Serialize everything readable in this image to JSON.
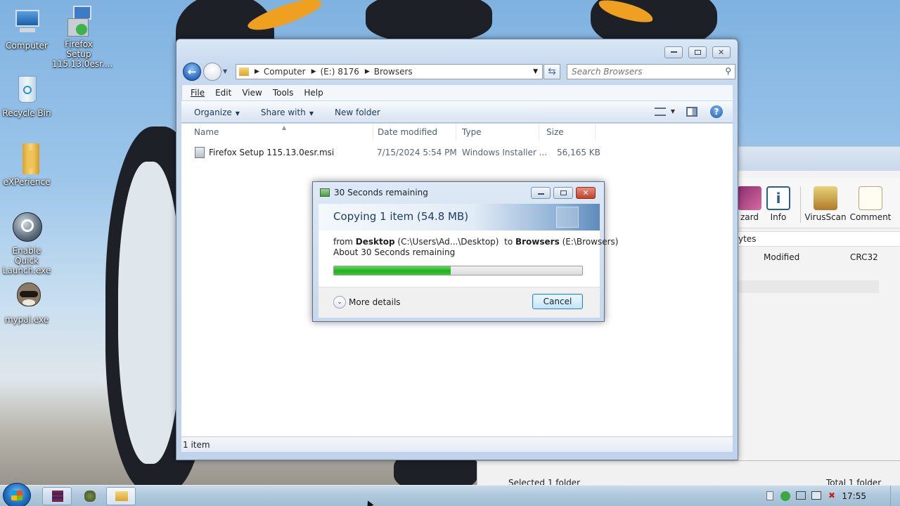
{
  "desktop": {
    "icons": [
      {
        "label": "Computer",
        "icon": "computer-icon"
      },
      {
        "label": "Firefox Setup 115.13.0esr....",
        "icon": "installer-icon"
      },
      {
        "label": "Recycle Bin",
        "icon": "recycle-bin-icon"
      },
      {
        "label": "eXPerience",
        "icon": "folder-icon"
      },
      {
        "label": "Enable Quick Launch.exe",
        "icon": "quick-launch-icon"
      },
      {
        "label": "mypal.exe",
        "icon": "raccoon-icon"
      }
    ]
  },
  "explorer": {
    "breadcrumb": [
      "Computer",
      "(E:) 8176",
      "Browsers"
    ],
    "search_placeholder": "Search Browsers",
    "menu": [
      "File",
      "Edit",
      "View",
      "Tools",
      "Help"
    ],
    "toolbar": {
      "organize": "Organize",
      "share_with": "Share with",
      "new_folder": "New folder"
    },
    "columns": {
      "name": "Name",
      "date_modified": "Date modified",
      "type": "Type",
      "size": "Size"
    },
    "files": [
      {
        "name": "Firefox Setup 115.13.0esr.msi",
        "date_modified": "7/15/2024 5:54 PM",
        "type": "Windows Installer ...",
        "size": "56,165 KB"
      }
    ],
    "status": "1 item"
  },
  "copy_dialog": {
    "title": "30 Seconds remaining",
    "heading": "Copying 1 item (54.8 MB)",
    "from_word": "from",
    "from_name": "Desktop",
    "from_path": "(C:\\Users\\Ad...\\Desktop)",
    "to_word": "to",
    "to_name": "Browsers",
    "to_path": "(E:\\Browsers)",
    "remaining": "About 30 Seconds remaining",
    "progress": 0.47,
    "more_details": "More details",
    "cancel": "Cancel"
  },
  "background_window": {
    "tools": [
      {
        "label": "zard",
        "icon": "wizard-icon"
      },
      {
        "label": "Info",
        "icon": "info-icon"
      },
      {
        "label": "VirusScan",
        "icon": "virus-scan-icon"
      },
      {
        "label": "Comment",
        "icon": "comment-icon"
      }
    ],
    "path_fragment": "ytes",
    "columns": [
      "Modified",
      "CRC32"
    ],
    "status_left": "Selected 1 folder",
    "status_right": "Total 1 folder"
  },
  "taskbar": {
    "clock": "17:55"
  },
  "colors": {
    "progress_green": "#1fb01b",
    "accent_blue": "#1f3b66",
    "close_red": "#c5412b"
  }
}
